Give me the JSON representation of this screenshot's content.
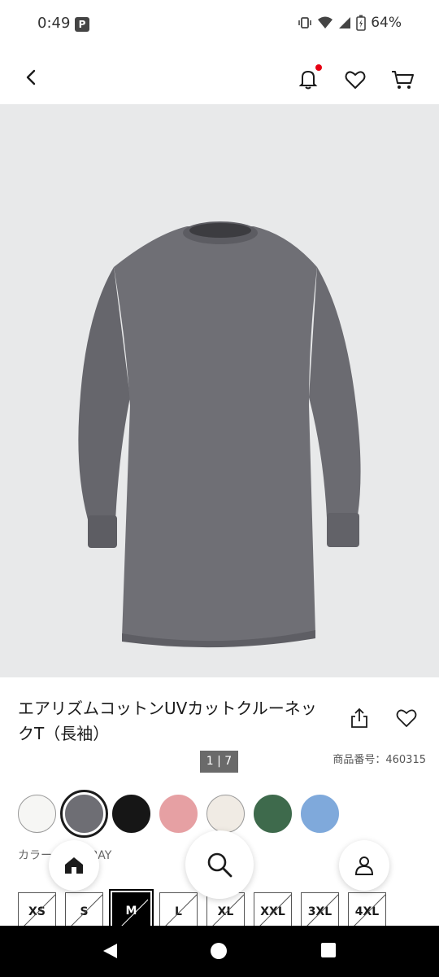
{
  "status": {
    "time": "0:49",
    "pay_badge": "P",
    "battery": "64%"
  },
  "header": {
    "notification_dot_color": "#e60012"
  },
  "product": {
    "pager": "1 | 7",
    "sku": "商品番号：460315",
    "title": "エアリズムコットンUVカットクルーネックT（長袖）",
    "color_label": "カラー：03 GRAY",
    "colors": [
      "#f6f6f4",
      "#6e6e74",
      "#161616",
      "#e6a0a3",
      "#f0ebe4",
      "#3e6a4c",
      "#7fa9db"
    ],
    "selected_color_index": 1,
    "sizes": [
      "XS",
      "S",
      "M",
      "L",
      "XL",
      "XXL",
      "3XL",
      "4XL"
    ],
    "selected_size_index": 2
  }
}
